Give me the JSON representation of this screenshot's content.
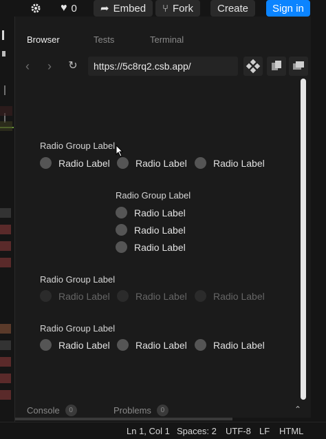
{
  "topbar": {
    "like_count": "0",
    "embed_label": "Embed",
    "fork_label": "Fork",
    "create_label": "Create",
    "signin_label": "Sign in"
  },
  "tabs": {
    "browser": "Browser",
    "tests": "Tests",
    "terminal": "Terminal"
  },
  "browser": {
    "url": "https://5c8rq2.csb.app/"
  },
  "groups": [
    {
      "label": "Radio Group Label",
      "options": [
        "Radio Label",
        "Radio Label",
        "Radio Label"
      ],
      "disabled": false
    },
    {
      "label": "Radio Group Label",
      "options": [
        "Radio Label",
        "Radio Label",
        "Radio Label"
      ],
      "disabled": false
    },
    {
      "label": "Radio Group Label",
      "options": [
        "Radio Label",
        "Radio Label",
        "Radio Label"
      ],
      "disabled": true
    },
    {
      "label": "Radio Group Label",
      "options": [
        "Radio Label",
        "Radio Label",
        "Radio Label"
      ],
      "disabled": false
    }
  ],
  "bottom_tabs": {
    "console": "Console",
    "console_count": "0",
    "problems": "Problems",
    "problems_count": "0"
  },
  "status": {
    "position": "Ln 1, Col 1",
    "spaces": "Spaces: 2",
    "encoding": "UTF-8",
    "eol": "LF",
    "language": "HTML"
  },
  "colors": {
    "accent": "#0b84ff",
    "background": "#1b1b1b"
  }
}
